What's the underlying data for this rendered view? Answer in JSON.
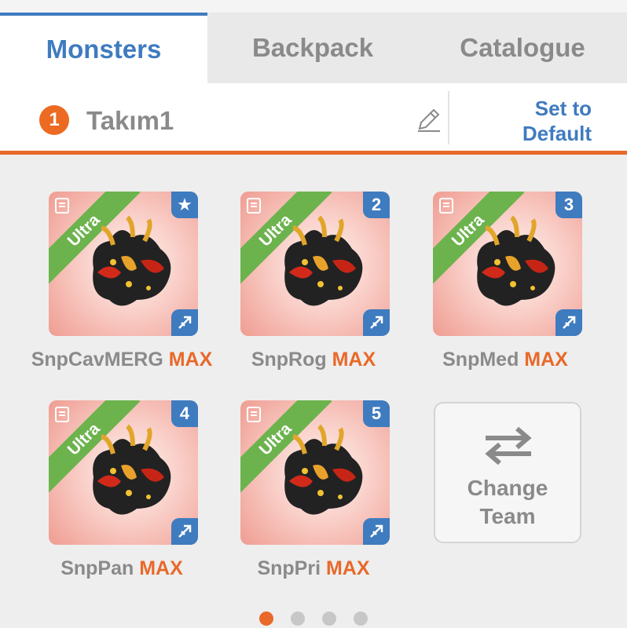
{
  "tabs": [
    "Monsters",
    "Backpack",
    "Catalogue"
  ],
  "team": {
    "number": "1",
    "name": "Takım1",
    "set_default_line1": "Set to",
    "set_default_line2": "Default"
  },
  "monsters": [
    {
      "name": "SnpCavMERG",
      "badge": "★",
      "rarity": "Ultra",
      "level": "MAX"
    },
    {
      "name": "SnpRog",
      "badge": "2",
      "rarity": "Ultra",
      "level": "MAX"
    },
    {
      "name": "SnpMed",
      "badge": "3",
      "rarity": "Ultra",
      "level": "MAX"
    },
    {
      "name": "SnpPan",
      "badge": "4",
      "rarity": "Ultra",
      "level": "MAX"
    },
    {
      "name": "SnpPri",
      "badge": "5",
      "rarity": "Ultra",
      "level": "MAX"
    }
  ],
  "change_team": {
    "line1": "Change",
    "line2": "Team"
  },
  "pager": {
    "pages": 4,
    "current": 1
  },
  "colors": {
    "accent_blue": "#3f7bbf",
    "accent_orange": "#e8692a",
    "ultra_green": "#6cb34d"
  }
}
